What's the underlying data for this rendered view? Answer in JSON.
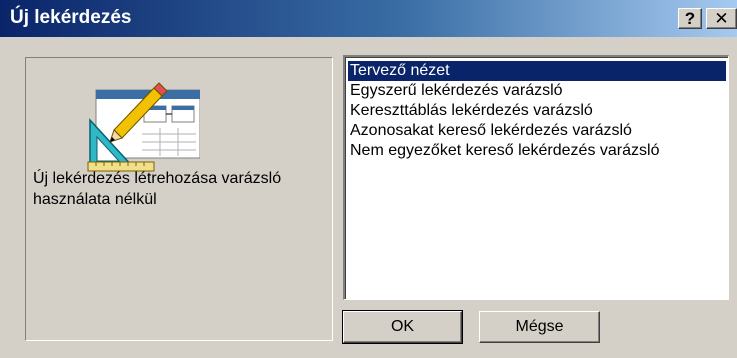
{
  "window": {
    "title": "Új lekérdezés",
    "help_label": "?",
    "close_label": "✕"
  },
  "left_panel": {
    "description": "Új lekérdezés létrehozása varázsló használata nélkül",
    "illustration_icon": "query-design-icon"
  },
  "list": {
    "items": [
      "Tervező nézet",
      "Egyszerű lekérdezés varázsló",
      "Kereszttáblás lekérdezés varázsló",
      "Azonosakat kereső lekérdezés varázsló",
      "Nem egyezőket kereső lekérdezés varázsló"
    ],
    "selected_index": 0
  },
  "buttons": {
    "ok_label": "OK",
    "cancel_label": "Mégse"
  },
  "colors": {
    "title_gradient_start": "#0a246a",
    "title_gradient_end": "#a6caf0",
    "selection": "#0a246a",
    "dialog_face": "#d4d0c8"
  }
}
